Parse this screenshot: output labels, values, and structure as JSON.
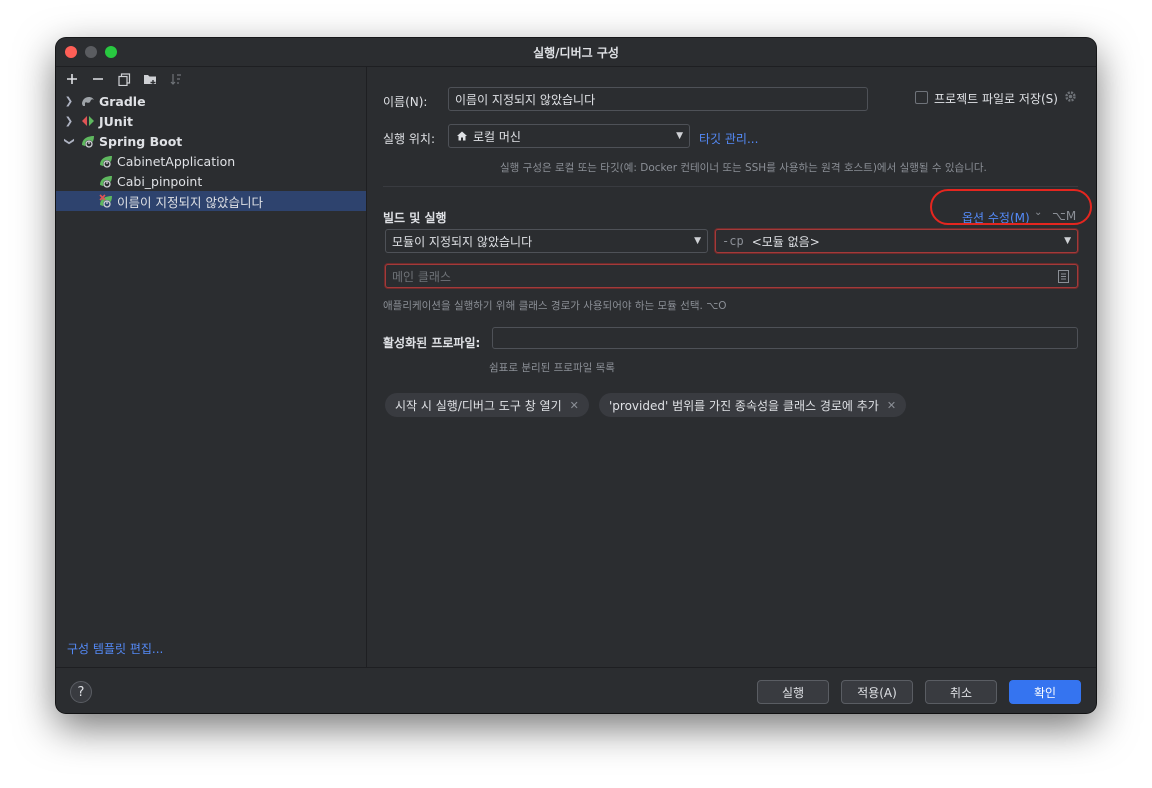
{
  "window": {
    "title": "실행/디버그 구성"
  },
  "sidebar": {
    "toolbar": [
      "add-icon",
      "remove-icon",
      "copy-icon",
      "new-folder-icon",
      "sort-icon"
    ],
    "tree": [
      {
        "label": "Gradle",
        "expanded": false,
        "icon": "gradle-icon"
      },
      {
        "label": "JUnit",
        "expanded": false,
        "icon": "junit-icon"
      },
      {
        "label": "Spring Boot",
        "expanded": true,
        "icon": "spring-boot-icon",
        "children": [
          {
            "label": "CabinetApplication",
            "icon": "spring-app-icon"
          },
          {
            "label": "Cabi_pinpoint",
            "icon": "spring-app-icon"
          },
          {
            "label": "이름이 지정되지 않았습니다",
            "icon": "spring-app-error-icon",
            "selected": true
          }
        ]
      }
    ],
    "footer_link": "구성 템플릿 편집..."
  },
  "form": {
    "name_label": "이름(N):",
    "name_value": "이름이 지정되지 않았습니다",
    "store_label": "프로젝트 파일로 저장(S)",
    "run_on_label": "실행 위치:",
    "run_on_value": "로컬 머신",
    "manage_targets": "타깃 관리...",
    "run_on_hint": "실행 구성은 로컬 또는 타깃(예: Docker 컨테이너 또는 SSH를 사용하는 원격 호스트)에서 실행될 수 있습니다.",
    "build_run_header": "빌드 및 실행",
    "modify_options": "옵션 수정(M)",
    "modify_shortcut": "⌥M",
    "module_value": "모듈이 지정되지 않았습니다",
    "cp_prefix": "-cp",
    "cp_value": "<모듈 없음>",
    "main_class_placeholder": "메인 클래스",
    "module_hint": "애플리케이션을 실행하기 위해 클래스 경로가 사용되어야 하는 모듈 선택. ⌥O",
    "profiles_label": "활성화된 프로파일:",
    "profiles_value": "",
    "profiles_hint": "쉼표로 분리된 프로파일 목록",
    "chips": [
      "시작 시 실행/디버그 도구 창 열기",
      "'provided' 범위를 가진 종속성을 클래스 경로에 추가"
    ]
  },
  "footer": {
    "help": "?",
    "run": "실행",
    "apply": "적용(A)",
    "cancel": "취소",
    "ok": "확인"
  },
  "colors": {
    "accent": "#3574f0",
    "link": "#548af7",
    "selection": "#2e436e",
    "error_border": "#a33a3a",
    "highlight_oval": "#e5261f"
  }
}
